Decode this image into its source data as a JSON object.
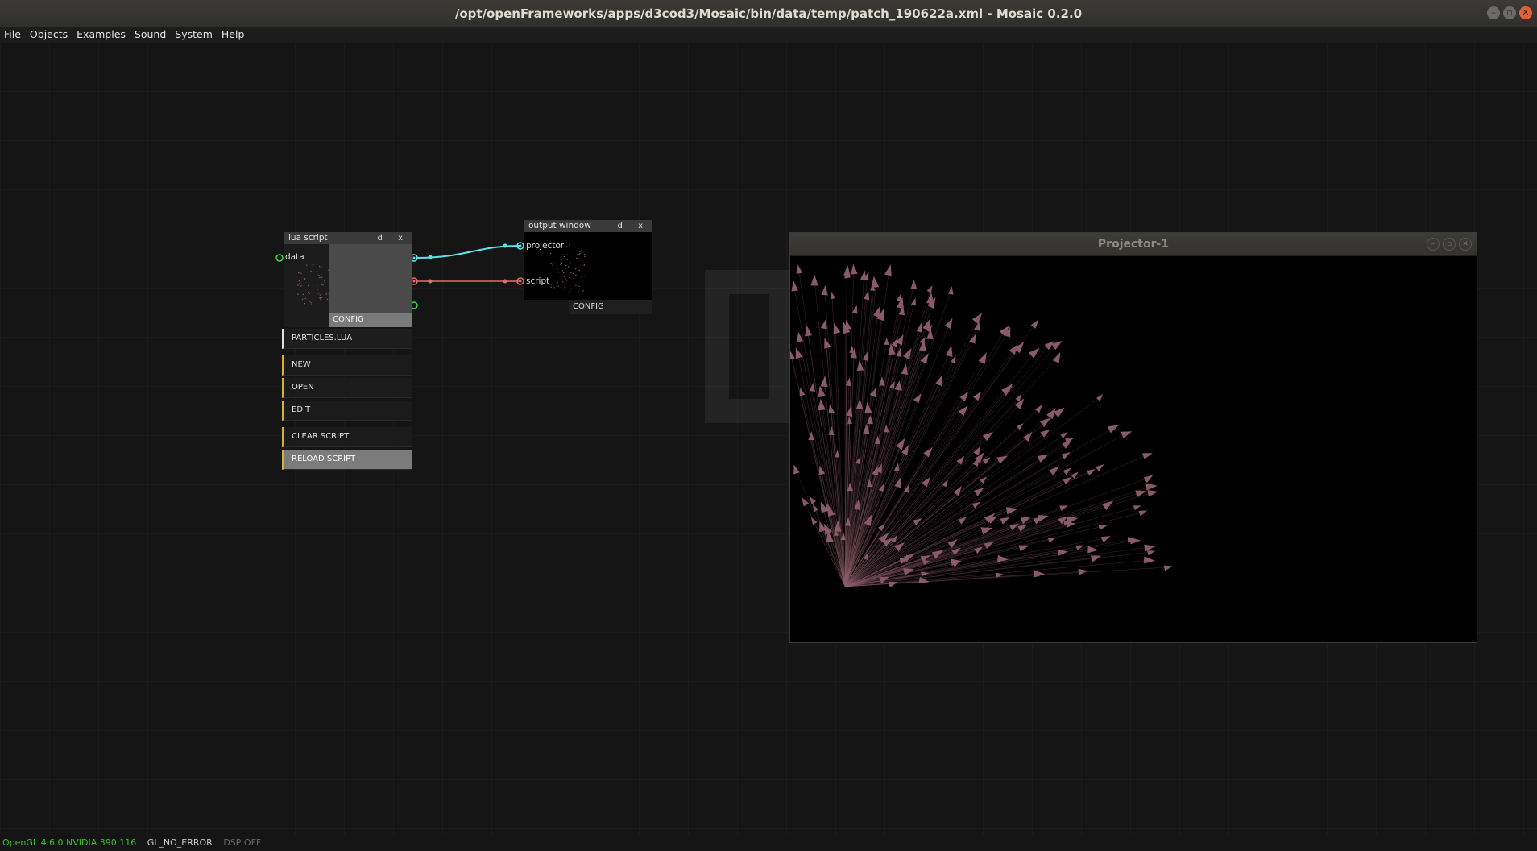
{
  "window": {
    "title": "/opt/openFrameworks/apps/d3cod3/Mosaic/bin/data/temp/patch_190622a.xml - Mosaic 0.2.0",
    "buttons": [
      "minimize-icon",
      "maximize-icon",
      "close-icon"
    ]
  },
  "menu": [
    "File",
    "Objects",
    "Examples",
    "Sound",
    "System",
    "Help"
  ],
  "lua_node": {
    "title": "lua script",
    "header_btns": "d x",
    "inlet_label": "data",
    "config_label": "CONFIG",
    "file_label": "PARTICLES.LUA",
    "buttons": [
      "NEW",
      "OPEN",
      "EDIT",
      "CLEAR SCRIPT",
      "RELOAD SCRIPT"
    ]
  },
  "output_node": {
    "title": "output window",
    "header_btns": "d x",
    "inlets": [
      "projector",
      "script"
    ],
    "config_label": "CONFIG"
  },
  "cables": {
    "projector_color": "#5fe3ea",
    "script_color": "#e86b6b"
  },
  "projector": {
    "title": "Projector-1",
    "particle_color": "#8a5a68"
  },
  "status": {
    "opengl": "OpenGL 4.6.0 NVIDIA 390.116",
    "gl_error": "GL_NO_ERROR",
    "dsp": "DSP OFF"
  }
}
